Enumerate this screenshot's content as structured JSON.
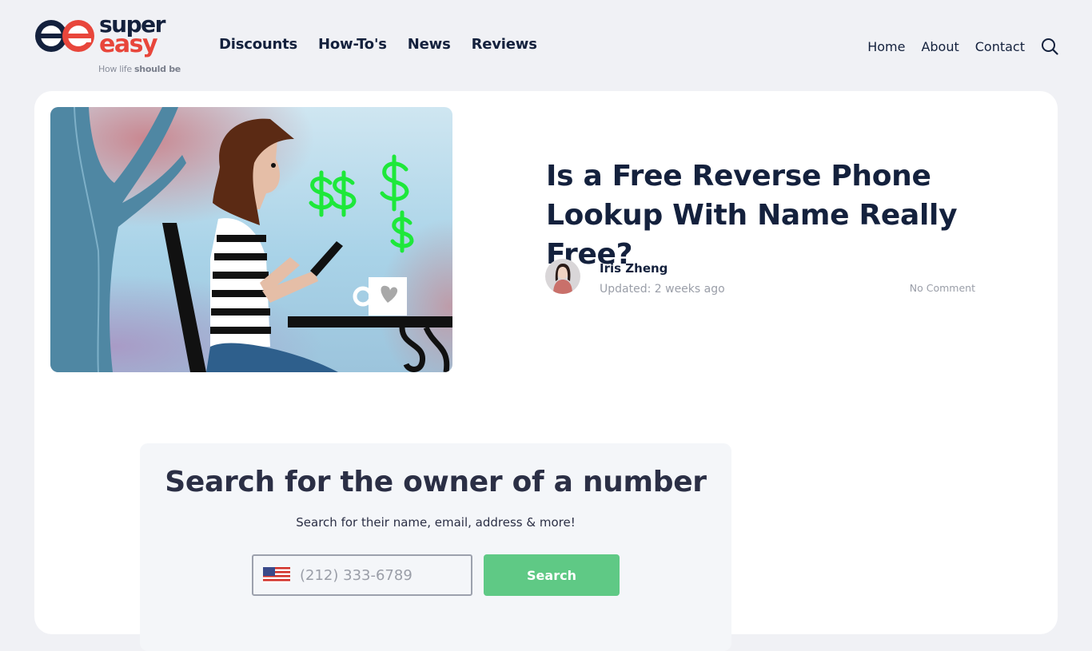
{
  "brand": {
    "word_top": "super",
    "word_bottom": "easy",
    "tagline_prefix": "How life ",
    "tagline_bold": "should be",
    "colors": {
      "navy": "#14213d",
      "red": "#e8463b"
    }
  },
  "main_nav": [
    {
      "label": "Discounts"
    },
    {
      "label": "How-To's"
    },
    {
      "label": "News"
    },
    {
      "label": "Reviews"
    }
  ],
  "utility_nav": [
    {
      "label": "Home"
    },
    {
      "label": "About"
    },
    {
      "label": "Contact"
    }
  ],
  "utility_icons": {
    "search": "search-icon"
  },
  "article": {
    "hero_image_alt": "Illustration of a woman at a cafe table looking at her phone with green dollar signs",
    "title": "Is a Free Reverse Phone Lookup With Name Really Free?",
    "author": "Iris Zheng",
    "updated": "Updated: 2 weeks ago",
    "comments": "No Comment"
  },
  "search_widget": {
    "title": "Search for the owner of a number",
    "subtitle": "Search for their name, email, address & more!",
    "phone_placeholder": "(212) 333-6789",
    "phone_value": "",
    "country_icon": "us-flag-icon",
    "button_label": "Search",
    "button_color": "#5fc985"
  }
}
